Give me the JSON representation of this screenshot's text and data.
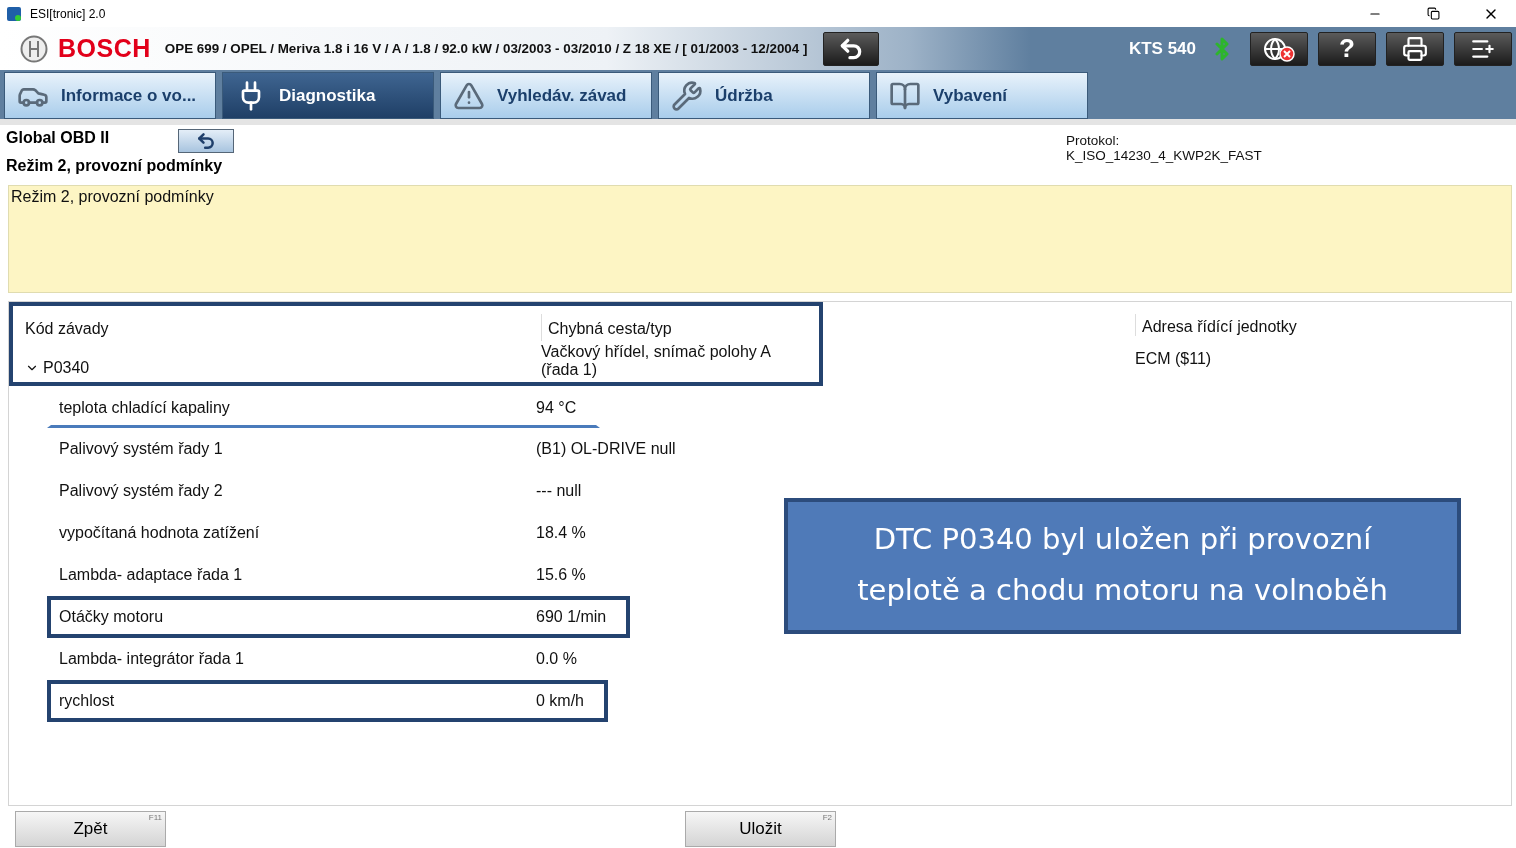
{
  "window": {
    "title": "ESI[tronic] 2.0"
  },
  "header": {
    "brand": "BOSCH",
    "vehicle": "OPE 699 / OPEL / Meriva 1.8 i 16 V / A / 1.8 / 92.0 kW / 03/2003 - 03/2010 / Z 18 XE / [ 01/2003 - 12/2004 ]",
    "device": "KTS 540",
    "help": "?"
  },
  "tabs": [
    {
      "label": "Informace o vo...",
      "selected": false
    },
    {
      "label": "Diagnostika",
      "selected": true
    },
    {
      "label": "Vyhledáv. závad",
      "selected": false
    },
    {
      "label": "Údržba",
      "selected": false
    },
    {
      "label": "Vybavení",
      "selected": false
    }
  ],
  "info": {
    "system": "Global OBD II",
    "mode": "Režim 2,  provozní podmínky",
    "protocol_label": "Protokol:",
    "protocol": "K_ISO_14230_4_KWP2K_FAST"
  },
  "description": "Režim 2,  provozní podmínky",
  "table": {
    "columns": [
      "Kód závady",
      "Chybná cesta/typ",
      "Adresa řídící jednotky"
    ],
    "header_boxed": true,
    "fault": {
      "code": "P0340",
      "expanded": true,
      "path": "Vačkový hřídel, snímač polohy A (řada 1)",
      "address": "ECM ($11)"
    },
    "rows": [
      {
        "name": "teplota chladící kapaliny",
        "value": "94 °C",
        "boxed": false,
        "underlined": true
      },
      {
        "name": "Palivový systém řady 1",
        "value": "(B1) OL-DRIVE null",
        "boxed": false,
        "underlined": false
      },
      {
        "name": "Palivový systém řady 2",
        "value": "--- null",
        "boxed": false,
        "underlined": false
      },
      {
        "name": "vypočítaná hodnota zatížení",
        "value": "18.4 %",
        "boxed": false,
        "underlined": false
      },
      {
        "name": "Lambda- adaptace řada 1",
        "value": "15.6 %",
        "boxed": false,
        "underlined": false
      },
      {
        "name": "Otáčky motoru",
        "value": "690 1/min",
        "boxed": true,
        "underlined": false
      },
      {
        "name": "Lambda- integrátor řada 1",
        "value": "0.0 %",
        "boxed": false,
        "underlined": false
      },
      {
        "name": "rychlost",
        "value": "0 km/h",
        "boxed": true,
        "underlined": false
      }
    ]
  },
  "callout": "DTC P0340 byl uložen při provozní teplotě a chodu motoru na volnoběh",
  "buttons": [
    {
      "label": "Zpět",
      "key": "F11"
    },
    {
      "label": "Uložit",
      "key": "F2"
    }
  ]
}
